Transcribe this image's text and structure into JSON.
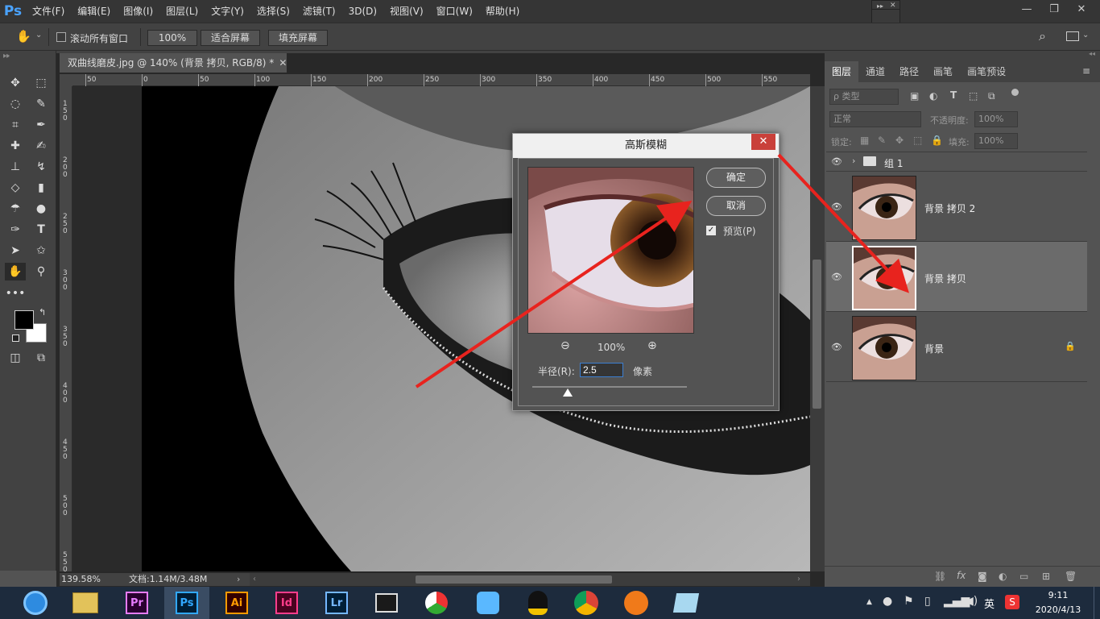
{
  "app": {
    "logo": "Ps"
  },
  "menu": [
    "文件(F)",
    "编辑(E)",
    "图像(I)",
    "图层(L)",
    "文字(Y)",
    "选择(S)",
    "滤镜(T)",
    "3D(D)",
    "视图(V)",
    "窗口(W)",
    "帮助(H)"
  ],
  "options": {
    "scroll_all_label": "滚动所有窗口",
    "zoom_btn": "100%",
    "fit_screen": "适合屏幕",
    "fill_screen": "填充屏幕"
  },
  "document": {
    "tab_title": "双曲线磨皮.jpg @ 140% (背景 拷贝, RGB/8) *",
    "zoom": "139.58%",
    "doc_info": "文档:1.14M/3.48M"
  },
  "rulers": {
    "horizontal": [
      "50",
      "0",
      "50",
      "100",
      "150",
      "200",
      "250",
      "300",
      "350",
      "400",
      "450",
      "500",
      "550"
    ],
    "vertical": [
      "1\n5\n0",
      "2\n0\n0",
      "2\n5\n0",
      "3\n0\n0",
      "3\n5\n0",
      "4\n0\n0",
      "4\n5\n0",
      "5\n0\n0",
      "5\n5\n0"
    ]
  },
  "dialog": {
    "title": "高斯模糊",
    "ok": "确定",
    "cancel": "取消",
    "preview_label": "预览(P)",
    "preview_checked": true,
    "zoom": "100%",
    "radius_label": "半径(R):",
    "radius_value": "2.5",
    "unit": "像素",
    "slider_value": 2.5
  },
  "panel": {
    "tabs": [
      "图层",
      "通道",
      "路径",
      "画笔",
      "画笔预设"
    ],
    "filter_kind": "ρ 类型",
    "blend_mode": "正常",
    "opacity_label": "不透明度:",
    "opacity_value": "100%",
    "lock_label": "锁定:",
    "fill_label": "填充:",
    "fill_value": "100%",
    "layers": [
      {
        "name": "组 1",
        "type": "group"
      },
      {
        "name": "背景 拷贝 2",
        "type": "pixel"
      },
      {
        "name": "背景 拷贝",
        "type": "pixel",
        "selected": true
      },
      {
        "name": "背景",
        "type": "pixel",
        "locked": true
      }
    ]
  },
  "taskbar": {
    "apps": [
      {
        "label": "Pr",
        "color": "#e77cff"
      },
      {
        "label": "Ps",
        "color": "#31a8ff"
      },
      {
        "label": "Ai",
        "color": "#ff9a00"
      },
      {
        "label": "Id",
        "color": "#ff3d8b"
      },
      {
        "label": "Lr",
        "color": "#74b7ff"
      }
    ],
    "ime": "英",
    "time": "9:11",
    "date": "2020/4/13"
  },
  "colors": {
    "accent_blue": "#31a8ff",
    "close_red": "#c9403a",
    "annotation_arrow": "#e8231e"
  }
}
